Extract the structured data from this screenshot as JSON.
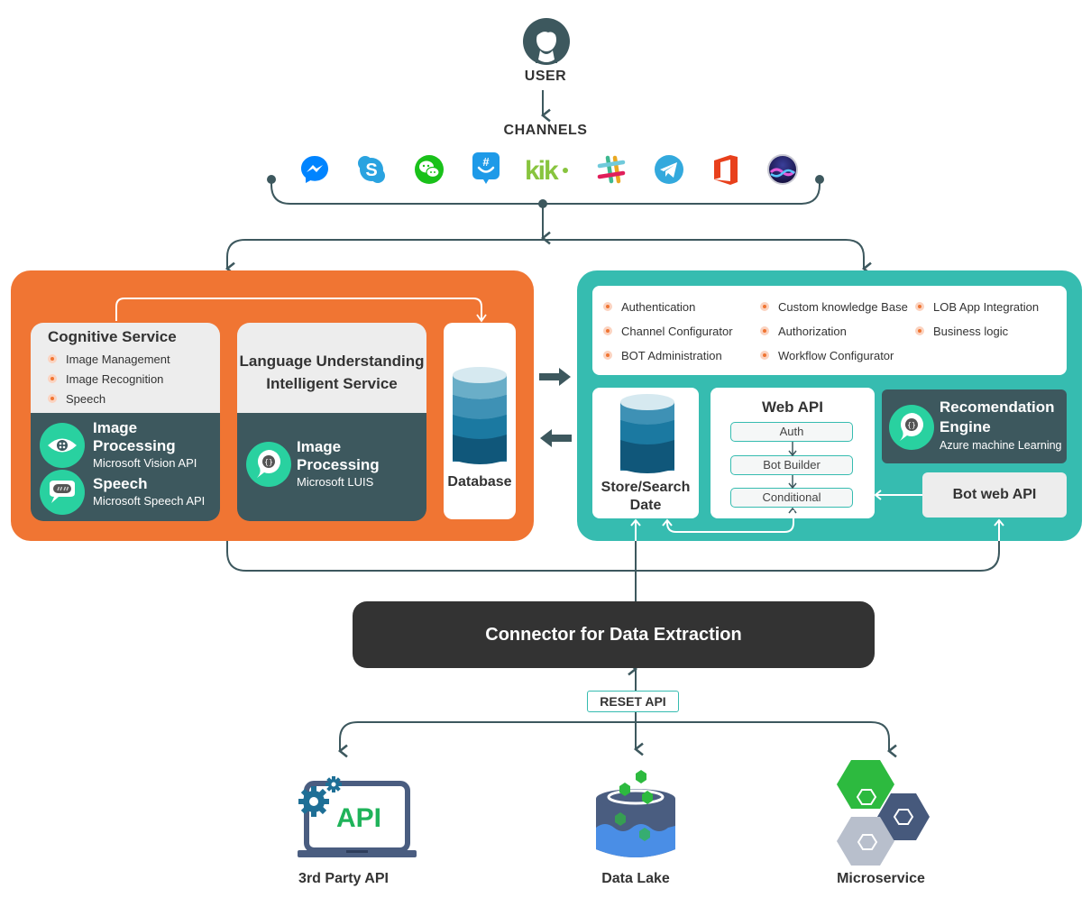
{
  "user": {
    "label": "USER",
    "icon": "user-avatar-icon"
  },
  "channels": {
    "label": "CHANNELS",
    "items": [
      {
        "name": "Messenger",
        "icon": "messenger-icon",
        "color": "#0084ff"
      },
      {
        "name": "Skype",
        "icon": "skype-icon",
        "color": "#2aa3e0"
      },
      {
        "name": "WeChat",
        "icon": "wechat-icon",
        "color": "#19c11a"
      },
      {
        "name": "GroupMe",
        "icon": "groupme-icon",
        "color": "#1e9ae8"
      },
      {
        "name": "Kik",
        "icon": "kik-icon",
        "color": "#88c43e"
      },
      {
        "name": "Slack",
        "icon": "slack-icon",
        "color": "#e01e5a"
      },
      {
        "name": "Telegram",
        "icon": "telegram-icon",
        "color": "#33a9dd"
      },
      {
        "name": "Office 365",
        "icon": "office-icon",
        "color": "#e8401c"
      },
      {
        "name": "Cortana/Siri",
        "icon": "siri-icon",
        "color": "#5a3cc8"
      }
    ]
  },
  "colors": {
    "orange": "#f07533",
    "teal": "#36bcb0",
    "dark": "#3d585e",
    "connector": "#333333",
    "line": "#3d585e",
    "accent_green": "#29d1a0"
  },
  "cognitive": {
    "title": "Cognitive Service",
    "bullets": [
      "Image Management",
      "Image Recognition",
      "Speech"
    ],
    "services": [
      {
        "title": "Image Processing",
        "sub": "Microsoft Vision API",
        "icon": "eye-icon"
      },
      {
        "title": "Speech",
        "sub": "Microsoft Speech API",
        "icon": "speech-bubble-icon"
      }
    ]
  },
  "luis": {
    "title_line1": "Language Understanding",
    "title_line2": "Intelligent Service",
    "service": {
      "title": "Image Processing",
      "sub": "Microsoft LUIS",
      "icon": "code-bubble-icon"
    }
  },
  "database": {
    "label": "Database"
  },
  "bot_features": {
    "columns": [
      [
        "Authentication",
        "Channel Configurator",
        "BOT Administration"
      ],
      [
        "Custom knowledge Base",
        "Authorization",
        "Workflow Configurator"
      ],
      [
        "LOB App Integration",
        "Business logic"
      ]
    ]
  },
  "store": {
    "line1": "Store/Search",
    "line2": "Date"
  },
  "webapi": {
    "title": "Web API",
    "steps": [
      "Auth",
      "Bot Builder",
      "Conditional"
    ]
  },
  "recommendation": {
    "title_line1": "Recomendation",
    "title_line2": "Engine",
    "sub": "Azure machine Learning"
  },
  "bot_web_api": {
    "label": "Bot web API"
  },
  "connector": {
    "label": "Connector for Data Extraction"
  },
  "reset_api": {
    "label": "RESET API"
  },
  "sources": [
    {
      "label": "3rd Party API",
      "icon": "api-laptop-icon",
      "icon_text": "API"
    },
    {
      "label": "Data Lake",
      "icon": "data-lake-icon"
    },
    {
      "label": "Microservice",
      "icon": "microservice-hexagons-icon"
    }
  ]
}
